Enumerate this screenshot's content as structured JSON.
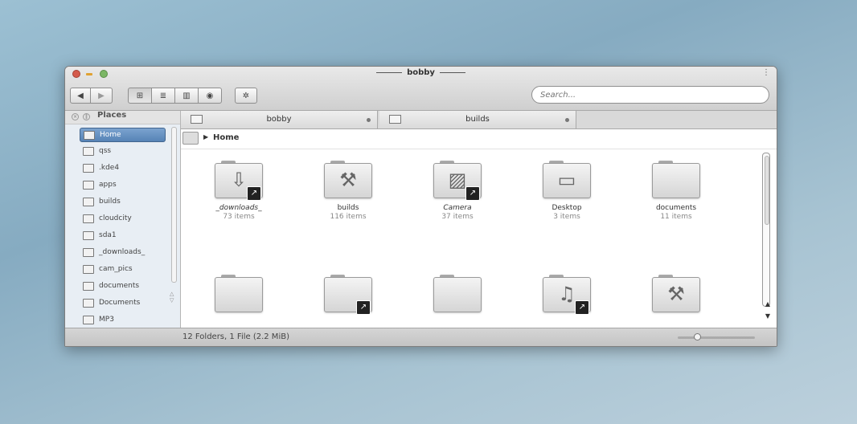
{
  "window": {
    "title": "bobby",
    "menu_glyph": "⋮"
  },
  "toolbar": {
    "back_icon": "◀",
    "forward_icon": "▶",
    "icons_view_icon": "⊞",
    "details_view_icon": "≣",
    "columns_view_icon": "▥",
    "preview_icon": "◉",
    "settings_icon": "✲",
    "search_placeholder": "Search..."
  },
  "sidebar": {
    "header": "Places",
    "items": [
      {
        "label": "Home",
        "selected": true
      },
      {
        "label": "qss"
      },
      {
        "label": ".kde4"
      },
      {
        "label": "apps"
      },
      {
        "label": "builds"
      },
      {
        "label": "cloudcity"
      },
      {
        "label": "sda1"
      },
      {
        "label": "_downloads_"
      },
      {
        "label": "cam_pics"
      },
      {
        "label": "documents"
      },
      {
        "label": "Documents"
      },
      {
        "label": "MP3"
      }
    ]
  },
  "tabs": [
    {
      "label": "bobby"
    },
    {
      "label": "builds"
    }
  ],
  "breadcrumb": {
    "current": "Home",
    "separator": "▶"
  },
  "files": [
    {
      "name": "_downloads_",
      "count": "73 items",
      "emblem": "⇩",
      "link": true
    },
    {
      "name": "builds",
      "count": "116 items",
      "emblem": "⚒",
      "link": false
    },
    {
      "name": "Camera",
      "count": "37 items",
      "emblem": "▨",
      "link": true
    },
    {
      "name": "Desktop",
      "count": "3 items",
      "emblem": "▭",
      "link": false
    },
    {
      "name": "documents",
      "count": "11 items",
      "emblem": "",
      "link": false
    },
    {
      "name": "",
      "count": "",
      "emblem": "",
      "link": false
    },
    {
      "name": "",
      "count": "",
      "emblem": "",
      "link": true
    },
    {
      "name": "",
      "count": "",
      "emblem": "",
      "link": false
    },
    {
      "name": "",
      "count": "",
      "emblem": "♫",
      "link": true
    },
    {
      "name": "",
      "count": "",
      "emblem": "⚒",
      "link": false
    }
  ],
  "link_glyph": "↗",
  "status": {
    "text": "12 Folders, 1 File (2.2 MiB)",
    "zoom_level": 0.25
  }
}
